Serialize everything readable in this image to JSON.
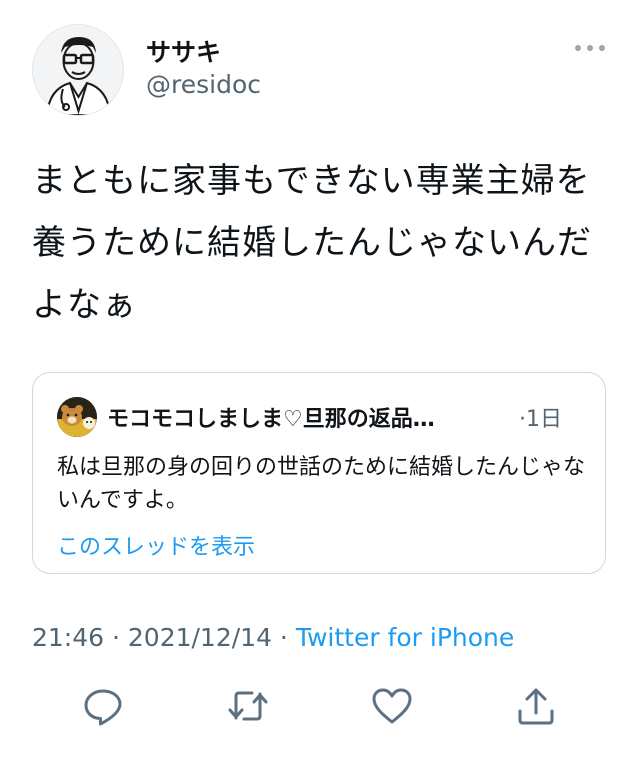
{
  "author": {
    "display_name": "ササキ",
    "handle": "@residoc",
    "avatar": "doctor-avatar"
  },
  "tweet": {
    "text": "まともに家事もできない専業主婦を養うために結婚したんじゃないんだよなぁ"
  },
  "quoted_tweet": {
    "display_name": "モコモコしましま♡旦那の返品…",
    "time": "·1日",
    "text": "私は旦那の身の回りの世話のために結婚したんじゃないんですよ。",
    "show_thread_label": "このスレッドを表示"
  },
  "meta": {
    "time": "21:46",
    "separator1": " · ",
    "date": "2021/12/14",
    "separator2": " · ",
    "source": "Twitter for iPhone"
  },
  "icons": {
    "more": "more-dots-icon",
    "reply": "reply-icon",
    "retweet": "retweet-icon",
    "like": "like-icon",
    "share": "share-icon"
  },
  "colors": {
    "text": "#0f1419",
    "secondary": "#536471",
    "link": "#1d9bf0",
    "border": "#cfd9de",
    "icon": "#5b7083"
  }
}
